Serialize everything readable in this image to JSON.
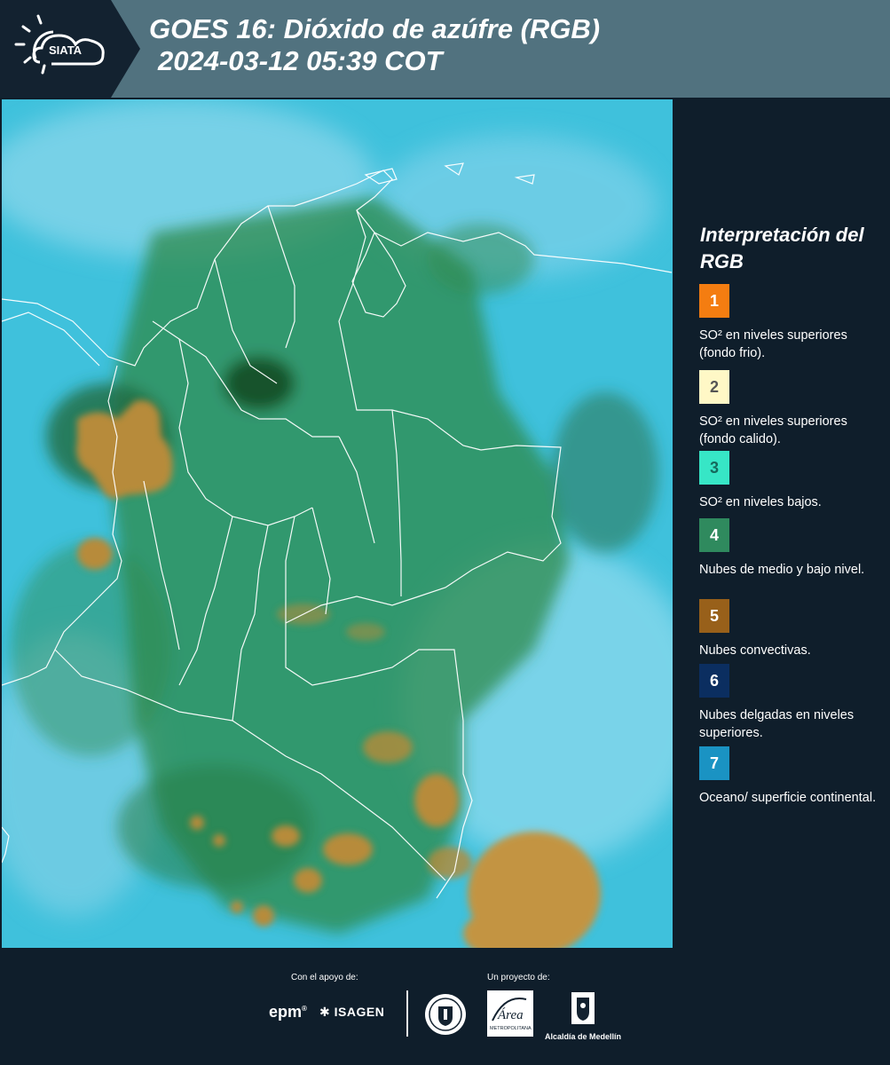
{
  "header": {
    "logo_text": "SIATA",
    "title_line1": "GOES 16: Dióxido de azúfre (RGB)",
    "title_line2": "2024-03-12 05:39 COT",
    "background_color": "#51727f"
  },
  "legend": {
    "title": "Interpretación del RGB",
    "items": [
      {
        "number": "1",
        "label": "SO² en niveles superiores (fondo frio).",
        "color": "#f47d11",
        "text_color": "#ffffff"
      },
      {
        "number": "2",
        "label": "SO² en niveles superiores (fondo calido).",
        "color": "#fff8c6",
        "text_color": "#555555"
      },
      {
        "number": "3",
        "label": "SO² en niveles bajos.",
        "color": "#37e6c6",
        "text_color": "#15695c"
      },
      {
        "number": "4",
        "label": "Nubes de medio y bajo nivel.",
        "color": "#2f8a5e",
        "text_color": "#ffffff"
      },
      {
        "number": "5",
        "label": "Nubes convectivas.",
        "color": "#98601a",
        "text_color": "#ffffff"
      },
      {
        "number": "6",
        "label": "Nubes delgadas en niveles superiores.",
        "color": "#0b2e60",
        "text_color": "#ffffff"
      },
      {
        "number": "7",
        "label": "Oceano/ superficie continental.",
        "color": "#1a93c3",
        "text_color": "#ffffff"
      }
    ]
  },
  "map": {
    "description_colors": {
      "ocean": "#3fc1dc",
      "vegetation": "#2f8a4b",
      "convective": "#b78b3a",
      "border": "#ffffff"
    }
  },
  "footer": {
    "support_label": "Con el apoyo de:",
    "project_label": "Un proyecto de:",
    "sponsor_epm": "epm",
    "sponsor_isagen": "ISAGEN",
    "area_text": "Área",
    "area_subtext": "METROPOLITANA",
    "alcaldia_label": "Alcaldía de Medellín"
  }
}
